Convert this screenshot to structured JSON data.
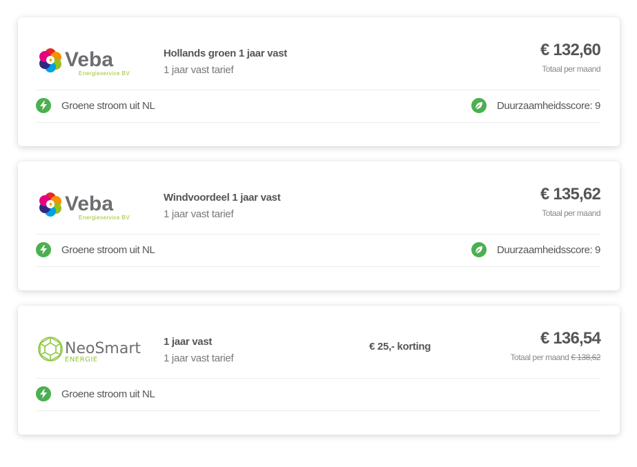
{
  "cards": [
    {
      "provider": "Veba",
      "provider_sub": "Energieservice BV",
      "plan_name": "Hollands groen 1 jaar vast",
      "plan_sub": "1 jaar vast tarief",
      "price": "€ 132,60",
      "price_note": "Totaal per maand",
      "feature_left": "Groene stroom uit NL",
      "feature_right": "Duurzaamheidsscore: 9"
    },
    {
      "provider": "Veba",
      "provider_sub": "Energieservice BV",
      "plan_name": "Windvoordeel 1 jaar vast",
      "plan_sub": "1 jaar vast tarief",
      "price": "€ 135,62",
      "price_note": "Totaal per maand",
      "feature_left": "Groene stroom uit NL",
      "feature_right": "Duurzaamheidsscore: 9"
    },
    {
      "provider": "NeoSmart",
      "provider_sub": "ENERGIE",
      "plan_name": "1 jaar vast",
      "plan_sub": "1 jaar vast tarief",
      "discount": "€ 25,- korting",
      "price": "€ 136,54",
      "price_note": "Totaal per maand",
      "price_old": "€ 138,62",
      "feature_left": "Groene stroom uit NL"
    }
  ],
  "colors": {
    "green": "#4caf50",
    "text": "#555555"
  },
  "icons": {
    "feature_left": "lightning-bolt-icon",
    "feature_right": "leaf-icon"
  }
}
